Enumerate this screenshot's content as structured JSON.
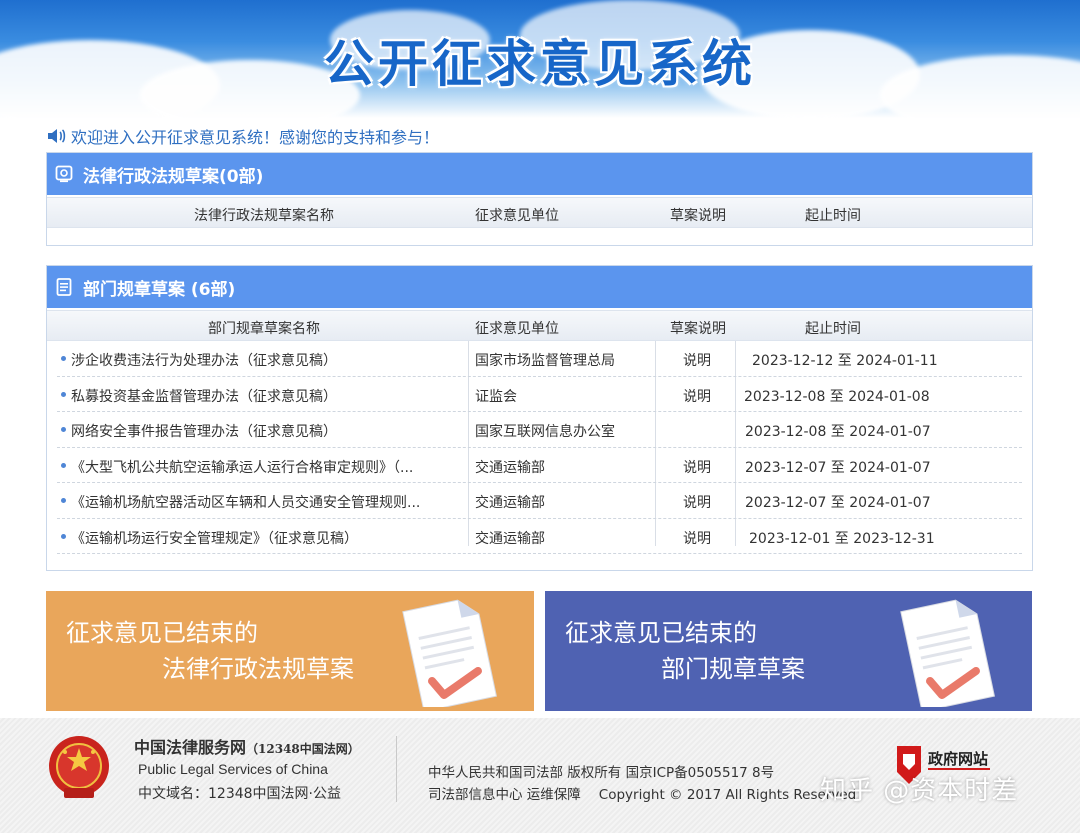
{
  "banner": {
    "title": "公开征求意见系统"
  },
  "welcome": {
    "text": "欢迎进入公开征求意见系统！感谢您的支持和参与！"
  },
  "panel_law": {
    "title": "法律行政法规草案(0部)",
    "columns": [
      "法律行政法规草案名称",
      "征求意见单位",
      "草案说明",
      "起止时间"
    ]
  },
  "panel_dept": {
    "title": "部门规章草案 (6部)",
    "columns": [
      "部门规章草案名称",
      "征求意见单位",
      "草案说明",
      "起止时间"
    ],
    "rows": [
      {
        "name": "涉企收费违法行为处理办法（征求意见稿）",
        "unit": "国家市场监督管理总局",
        "note": "说明",
        "period": "2023-12-12 至 2024-01-11"
      },
      {
        "name": "私募投资基金监督管理办法（征求意见稿）",
        "unit": "证监会",
        "note": "说明",
        "period": "2023-12-08 至 2024-01-08"
      },
      {
        "name": "网络安全事件报告管理办法（征求意见稿）",
        "unit": "国家互联网信息办公室",
        "note": "",
        "period": "2023-12-08 至 2024-01-07"
      },
      {
        "name": "《大型飞机公共航空运输承运人运行合格审定规则》（...",
        "unit": "交通运输部",
        "note": "说明",
        "period": "2023-12-07 至 2024-01-07"
      },
      {
        "name": "《运输机场航空器活动区车辆和人员交通安全管理规则...",
        "unit": "交通运输部",
        "note": "说明",
        "period": "2023-12-07 至 2024-01-07"
      },
      {
        "name": "《运输机场运行安全管理规定》（征求意见稿）",
        "unit": "交通运输部",
        "note": "说明",
        "period": "2023-12-01 至 2023-12-31"
      }
    ]
  },
  "closed_buttons": [
    {
      "line1": "征求意见已结束的",
      "line2": "法律行政法规草案",
      "color": "#e9a65b"
    },
    {
      "line1": "征求意见已结束的",
      "line2": "部门规章草案",
      "color": "#4f62b2"
    }
  ],
  "footer": {
    "site_cn": "中国法律服务网",
    "site_cn_sub": "（12348中国法网）",
    "site_en": "Public Legal Services of China",
    "domain": "中文域名：12348中国法网·公益",
    "copyright_line1": "中华人民共和国司法部 版权所有 国京ICP备0505517 8号",
    "maintenance": "司法部信息中心 运维保障",
    "copyright": "Copyright © 2017 All Rights Reserved",
    "gov_badge": "政府网站"
  },
  "watermark": "知乎 @资本时差",
  "colors": {
    "header_blue": "#5b95ee",
    "accent_orange": "#e9a65b",
    "accent_indigo": "#4f62b2"
  }
}
